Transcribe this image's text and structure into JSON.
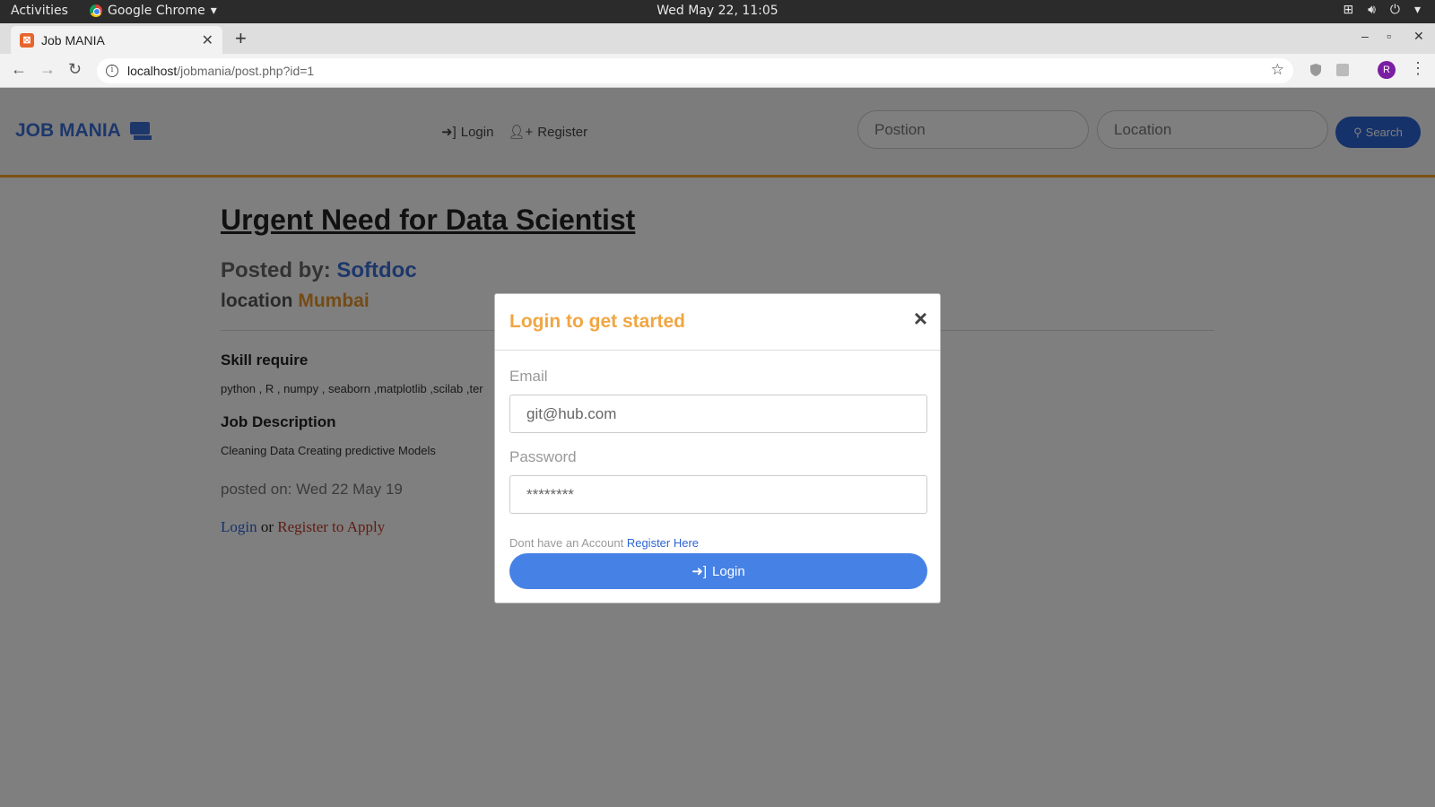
{
  "os_bar": {
    "activities": "Activities",
    "app_name": "Google Chrome",
    "clock": "Wed May 22, 11:05"
  },
  "browser": {
    "tab_title": "Job MANIA",
    "url_host": "localhost",
    "url_path": "/jobmania/post.php?id=1",
    "profile_initial": "R"
  },
  "site": {
    "brand": "JOB MANIA",
    "nav": {
      "login": "Login",
      "register": "Register"
    },
    "search": {
      "position_placeholder": "Postion",
      "location_placeholder": "Location",
      "button": "Search"
    }
  },
  "job": {
    "title": "Urgent Need for Data Scientist",
    "posted_by_label": "Posted by:",
    "company": "Softdoc",
    "location_label": "location",
    "city": "Mumbai",
    "skill_heading": "Skill require",
    "skills": "python , R , numpy , seaborn ,matplotlib ,scilab ,ter",
    "description_heading": "Job Description",
    "description": "Cleaning Data Creating predictive Models",
    "posted_on": "posted on: Wed 22 May 19",
    "apply_login": "Login",
    "apply_or": "or",
    "apply_register": "Register to Apply"
  },
  "modal": {
    "title": "Login to get started",
    "close": "×",
    "email_label": "Email",
    "email_placeholder": "git@hub.com",
    "password_label": "Password",
    "password_placeholder": "********",
    "no_account": "Dont have an Account",
    "register_here": "Register Here",
    "login_button": "Login"
  },
  "colors": {
    "brand_blue": "#3b6fd6",
    "accent_orange": "#f0a643",
    "button_blue": "#4682e6"
  }
}
